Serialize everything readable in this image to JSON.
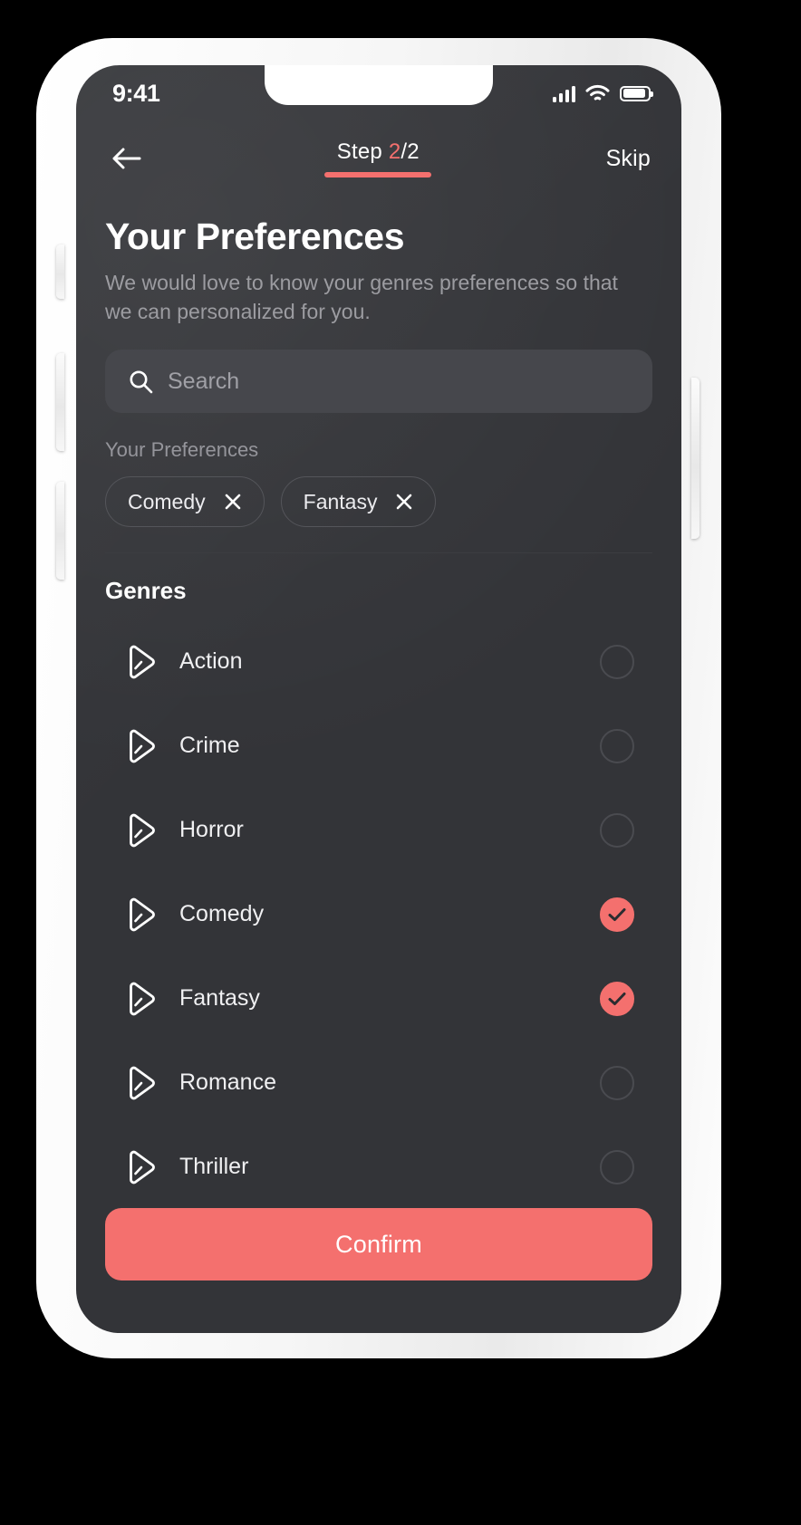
{
  "status_bar": {
    "time": "9:41",
    "signal_icon": "cellular-signal-icon",
    "wifi_icon": "wifi-icon",
    "battery_icon": "battery-icon"
  },
  "header": {
    "back_icon": "back-arrow-icon",
    "step_prefix": "Step ",
    "step_current": "2",
    "step_total": "/2",
    "skip_label": "Skip"
  },
  "page": {
    "title": "Your Preferences",
    "subtitle": "We would love to know your genres preferences so that we can personalized for you."
  },
  "search": {
    "placeholder": "Search",
    "value": "",
    "icon": "search-icon"
  },
  "preferences": {
    "label": "Your Preferences",
    "chips": [
      {
        "label": "Comedy",
        "remove_icon": "close-icon"
      },
      {
        "label": "Fantasy",
        "remove_icon": "close-icon"
      }
    ]
  },
  "genres": {
    "heading": "Genres",
    "items": [
      {
        "label": "Action",
        "selected": false
      },
      {
        "label": "Crime",
        "selected": false
      },
      {
        "label": "Horror",
        "selected": false
      },
      {
        "label": "Comedy",
        "selected": true
      },
      {
        "label": "Fantasy",
        "selected": true
      },
      {
        "label": "Romance",
        "selected": false
      },
      {
        "label": "Thriller",
        "selected": false
      }
    ]
  },
  "footer": {
    "confirm_label": "Confirm"
  },
  "colors": {
    "accent": "#F4706E",
    "screen_bg": "#333438",
    "search_bg": "#46474C",
    "muted_text": "#9C9CA1"
  }
}
